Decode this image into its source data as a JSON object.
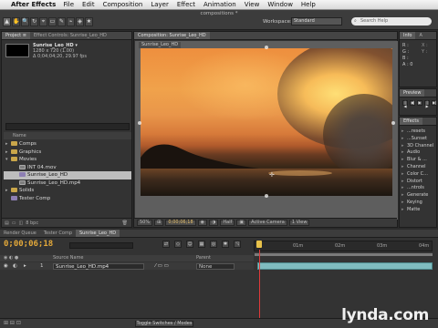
{
  "menubar": {
    "app": "After Effects",
    "items": [
      "File",
      "Edit",
      "Composition",
      "Layer",
      "Effect",
      "Animation",
      "View",
      "Window",
      "Help"
    ]
  },
  "window": {
    "title": "compositions *",
    "workspace_label": "Workspace:",
    "workspace_value": "Standard",
    "search_placeholder": "Search Help"
  },
  "tools": [
    "▲",
    "✋",
    "🔍",
    "↻",
    "⌖",
    "▭",
    "✎",
    "⌁",
    "◈",
    "★"
  ],
  "project": {
    "tabs": [
      "Project ≡",
      "Effect Controls: Sunrise_Leo_HD"
    ],
    "selected_name": "Sunrise_Leo_HD ▾",
    "selected_res": "1280 x 720 (1.00)",
    "selected_dur": "Δ 0;04;04;20, 29.97 fps",
    "column_header": "Name",
    "items": [
      {
        "label": "Comps",
        "type": "folder",
        "indent": 0,
        "twirl": "▸"
      },
      {
        "label": "Graphics",
        "type": "folder",
        "indent": 0,
        "twirl": "▸"
      },
      {
        "label": "Movies",
        "type": "folder",
        "indent": 0,
        "twirl": "▾"
      },
      {
        "label": "INT 04.mov",
        "type": "film",
        "indent": 1,
        "twirl": ""
      },
      {
        "label": "Sunrise_Leo_HD",
        "type": "comp",
        "indent": 1,
        "twirl": "",
        "selected": true
      },
      {
        "label": "Sunrise_Leo_HD.mp4",
        "type": "film",
        "indent": 1,
        "twirl": ""
      },
      {
        "label": "Solids",
        "type": "folder",
        "indent": 0,
        "twirl": "▸"
      },
      {
        "label": "Tester Comp",
        "type": "comp",
        "indent": 0,
        "twirl": ""
      }
    ],
    "footer_bpc": "8 bpc"
  },
  "composition": {
    "tab": "Composition: Sunrise_Leo_HD",
    "subtab": "Sunrise_Leo_HD",
    "zoom": "50%",
    "timecode": "0;00;06;18",
    "resolution": "Half",
    "camera": "Active Camera",
    "views": "1 View"
  },
  "info_panel": {
    "tabs": [
      "Info",
      "A"
    ],
    "labels": [
      "R :",
      "G :",
      "B :",
      "A : 0"
    ],
    "coords": [
      "X :",
      "Y :"
    ]
  },
  "preview_panel": {
    "tab": "Preview",
    "buttons": [
      "|◀",
      "◀|",
      "▶",
      "|▶",
      "▶|"
    ]
  },
  "effects_panel": {
    "tab": "Effects",
    "items": [
      "...resets",
      "...Sunset",
      "3D Channel",
      "Audio",
      "Blur & ...",
      "Channel",
      "Color C...",
      "Distort",
      "...ntrols",
      "Generate",
      "Keying",
      "Matte"
    ]
  },
  "timeline": {
    "tabs": [
      "Render Queue",
      "Tester Comp",
      "Sunrise_Leo_HD"
    ],
    "timecode": "0;00;06;18",
    "ruler_labels": [
      "0f",
      "01m",
      "02m",
      "03m",
      "04m"
    ],
    "header": {
      "source": "Source Name",
      "parent": "Parent"
    },
    "layer": {
      "index": "1",
      "name": "Sunrise_Leo_HD.mp4",
      "parent": "None"
    },
    "toggle_label": "Toggle Switches / Modes"
  },
  "watermark": "lynda.com"
}
